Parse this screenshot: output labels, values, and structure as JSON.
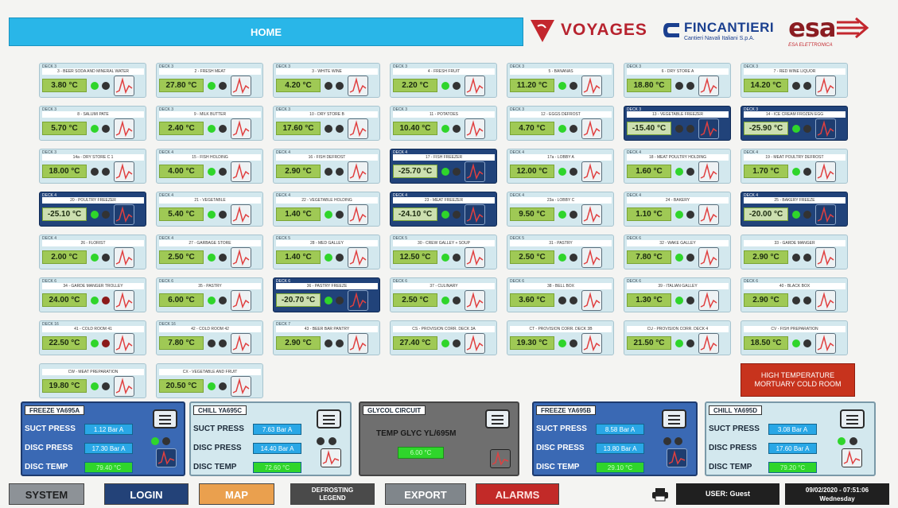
{
  "header": {
    "home_label": "HOME",
    "brands": {
      "voyages": "VOYAGES",
      "fincantieri": "FINCANTIERI",
      "fincantieri_sub": "Cantieri Navali Italiani S.p.A.",
      "esa": "esa",
      "esa_sub": "ESA ELETTRONICA"
    }
  },
  "tiles": [
    {
      "deck": "DECK 3",
      "name": "3 - BEER SODA AND MINERAL WATER",
      "temp": "3.80 °C",
      "d1": "#2fd52b",
      "d2": "#333",
      "frz": false
    },
    {
      "deck": "DECK 3",
      "name": "2 - FRESH MEAT",
      "temp": "27.80 °C",
      "d1": "#2fd52b",
      "d2": "#333",
      "frz": false
    },
    {
      "deck": "DECK 3",
      "name": "3 - WHITE WINE",
      "temp": "4.20 °C",
      "d1": "#333",
      "d2": "#333",
      "frz": false
    },
    {
      "deck": "DECK 3",
      "name": "4 - FRESH FRUIT",
      "temp": "2.20 °C",
      "d1": "#2fd52b",
      "d2": "#333",
      "frz": false
    },
    {
      "deck": "DECK 3",
      "name": "5 - BANANAS",
      "temp": "11.20 °C",
      "d1": "#2fd52b",
      "d2": "#333",
      "frz": false
    },
    {
      "deck": "DECK 3",
      "name": "6 - DRY STORE A",
      "temp": "18.80 °C",
      "d1": "#333",
      "d2": "#333",
      "frz": false
    },
    {
      "deck": "DECK 3",
      "name": "7 - RED WINE LIQUOR",
      "temp": "14.20 °C",
      "d1": "#333",
      "d2": "#333",
      "frz": false
    },
    {
      "deck": "DECK 3",
      "name": "8 - SALUMI PATE",
      "temp": "5.70 °C",
      "d1": "#2fd52b",
      "d2": "#333",
      "frz": false
    },
    {
      "deck": "DECK 3",
      "name": "9 - MILK BUTTER",
      "temp": "2.40 °C",
      "d1": "#2fd52b",
      "d2": "#333",
      "frz": false
    },
    {
      "deck": "DECK 3",
      "name": "10 - DRY STORE B",
      "temp": "17.60 °C",
      "d1": "#333",
      "d2": "#333",
      "frz": false
    },
    {
      "deck": "DECK 3",
      "name": "11 - POTATOES",
      "temp": "10.40 °C",
      "d1": "#2fd52b",
      "d2": "#333",
      "frz": false
    },
    {
      "deck": "DECK 3",
      "name": "12 - EGGS DEFROST",
      "temp": "4.70 °C",
      "d1": "#2fd52b",
      "d2": "#333",
      "frz": false
    },
    {
      "deck": "DECK 3",
      "name": "13 - VEGETABLE FREEZER",
      "temp": "-15.40 °C",
      "d1": "#333",
      "d2": "#333",
      "frz": true
    },
    {
      "deck": "DECK 3",
      "name": "14 - ICE CREAM FROZEN EGG",
      "temp": "-25.90 °C",
      "d1": "#2fd52b",
      "d2": "#333",
      "frz": true
    },
    {
      "deck": "DECK 3",
      "name": "14a - DRY STORE C 1",
      "temp": "18.00 °C",
      "d1": "#333",
      "d2": "#333",
      "frz": false
    },
    {
      "deck": "DECK 4",
      "name": "15 - FISH HOLDING",
      "temp": "4.00 °C",
      "d1": "#2fd52b",
      "d2": "#333",
      "frz": false
    },
    {
      "deck": "DECK 4",
      "name": "16 - FISH DEFROST",
      "temp": "2.90 °C",
      "d1": "#333",
      "d2": "#333",
      "frz": false
    },
    {
      "deck": "DECK 4",
      "name": "17 - FISH FREEZER",
      "temp": "-25.70 °C",
      "d1": "#2fd52b",
      "d2": "#333",
      "frz": true
    },
    {
      "deck": "DECK 4",
      "name": "17a - LOBBY A",
      "temp": "12.00 °C",
      "d1": "#2fd52b",
      "d2": "#333",
      "frz": false
    },
    {
      "deck": "DECK 4",
      "name": "18 - MEAT POULTRY HOLDING",
      "temp": "1.60 °C",
      "d1": "#2fd52b",
      "d2": "#333",
      "frz": false
    },
    {
      "deck": "DECK 4",
      "name": "19 - MEAT POULTRY DEFROST",
      "temp": "1.70 °C",
      "d1": "#2fd52b",
      "d2": "#333",
      "frz": false
    },
    {
      "deck": "DECK 4",
      "name": "20 - POULTRY FREEZER",
      "temp": "-25.10 °C",
      "d1": "#2fd52b",
      "d2": "#333",
      "frz": true
    },
    {
      "deck": "DECK 4",
      "name": "21 - VEGETABLE",
      "temp": "5.40 °C",
      "d1": "#2fd52b",
      "d2": "#333",
      "frz": false
    },
    {
      "deck": "DECK 4",
      "name": "22 - VEGETABLE HOLDING",
      "temp": "1.40 °C",
      "d1": "#2fd52b",
      "d2": "#333",
      "frz": false
    },
    {
      "deck": "DECK 4",
      "name": "23 - MEAT FREEZER",
      "temp": "-24.10 °C",
      "d1": "#2fd52b",
      "d2": "#333",
      "frz": true
    },
    {
      "deck": "DECK 4",
      "name": "23a - LOBBY C",
      "temp": "9.50 °C",
      "d1": "#2fd52b",
      "d2": "#333",
      "frz": false
    },
    {
      "deck": "DECK 4",
      "name": "24 - BAKERY",
      "temp": "1.10 °C",
      "d1": "#2fd52b",
      "d2": "#333",
      "frz": false
    },
    {
      "deck": "DECK 4",
      "name": "25 - BAKERY FREEZE",
      "temp": "-20.00 °C",
      "d1": "#2fd52b",
      "d2": "#333",
      "frz": true
    },
    {
      "deck": "DECK 4",
      "name": "26 - FLORIST",
      "temp": "2.00 °C",
      "d1": "#2fd52b",
      "d2": "#333",
      "frz": false
    },
    {
      "deck": "DECK 4",
      "name": "27 - GARBAGE STORE",
      "temp": "2.50 °C",
      "d1": "#2fd52b",
      "d2": "#333",
      "frz": false
    },
    {
      "deck": "DECK 5",
      "name": "28 - MED GALLEY",
      "temp": "1.40 °C",
      "d1": "#2fd52b",
      "d2": "#333",
      "frz": false
    },
    {
      "deck": "DECK 5",
      "name": "30 - CREW GALLEY + SOUP",
      "temp": "12.50 °C",
      "d1": "#2fd52b",
      "d2": "#333",
      "frz": false
    },
    {
      "deck": "DECK 5",
      "name": "31 - PASTRY",
      "temp": "2.50 °C",
      "d1": "#2fd52b",
      "d2": "#333",
      "frz": false
    },
    {
      "deck": "DECK 6",
      "name": "32 - WAKE GALLEY",
      "temp": "7.80 °C",
      "d1": "#2fd52b",
      "d2": "#333",
      "frz": false
    },
    {
      "deck": "",
      "name": "33 - GARDE MANGER",
      "temp": "2.90 °C",
      "d1": "#333",
      "d2": "#333",
      "frz": false
    },
    {
      "deck": "DECK 6",
      "name": "34 - GARDE MANGER TROLLEY",
      "temp": "24.00 °C",
      "d1": "#2fd52b",
      "d2": "#8b1a1a",
      "frz": false
    },
    {
      "deck": "DECK 6",
      "name": "35 - PASTRY",
      "temp": "6.00 °C",
      "d1": "#2fd52b",
      "d2": "#333",
      "frz": false
    },
    {
      "deck": "DECK 6",
      "name": "36 - PASTRY FREEZE",
      "temp": "-20.70 °C",
      "d1": "#2fd52b",
      "d2": "#333",
      "frz": true
    },
    {
      "deck": "DECK 6",
      "name": "37 - CULINARY",
      "temp": "2.50 °C",
      "d1": "#2fd52b",
      "d2": "#333",
      "frz": false
    },
    {
      "deck": "DECK 6",
      "name": "38 - BELL BOX",
      "temp": "3.60 °C",
      "d1": "#333",
      "d2": "#333",
      "frz": false
    },
    {
      "deck": "DECK 6",
      "name": "39 - ITALIAN GALLEY",
      "temp": "1.30 °C",
      "d1": "#2fd52b",
      "d2": "#333",
      "frz": false
    },
    {
      "deck": "DECK 6",
      "name": "40 - BLACK BOX",
      "temp": "2.90 °C",
      "d1": "#333",
      "d2": "#333",
      "frz": false
    },
    {
      "deck": "DECK 16",
      "name": "41 - COLD ROOM 41",
      "temp": "22.50 °C",
      "d1": "#2fd52b",
      "d2": "#8b1a1a",
      "frz": false
    },
    {
      "deck": "DECK 16",
      "name": "42 - COLD ROOM 42",
      "temp": "7.80 °C",
      "d1": "#333",
      "d2": "#333",
      "frz": false
    },
    {
      "deck": "DECK 7",
      "name": "43 - BEER BAR PANTRY",
      "temp": "2.90 °C",
      "d1": "#333",
      "d2": "#333",
      "frz": false
    },
    {
      "deck": "",
      "name": "CS - PROVISION CORR. DECK 3A",
      "temp": "27.40 °C",
      "d1": "#2fd52b",
      "d2": "#333",
      "frz": false
    },
    {
      "deck": "",
      "name": "CT - PROVISION CORR. DECK 3B",
      "temp": "19.30 °C",
      "d1": "#2fd52b",
      "d2": "#333",
      "frz": false
    },
    {
      "deck": "",
      "name": "CU - PROVISION CORR. DECK 4",
      "temp": "21.50 °C",
      "d1": "#2fd52b",
      "d2": "#333",
      "frz": false
    },
    {
      "deck": "",
      "name": "CV - FISH PREPARATION",
      "temp": "18.50 °C",
      "d1": "#2fd52b",
      "d2": "#333",
      "frz": false
    },
    {
      "deck": "",
      "name": "CW - MEAT PREPARATION",
      "temp": "19.80 °C",
      "d1": "#2fd52b",
      "d2": "#333",
      "frz": false
    },
    {
      "deck": "",
      "name": "CX - VEGETABLE AND FRUIT",
      "temp": "20.50 °C",
      "d1": "#2fd52b",
      "d2": "#333",
      "frz": false
    }
  ],
  "mortuary_alarm": "HIGH TEMPERATURE\nMORTUARY COLD ROOM",
  "panels": [
    {
      "title": "FREEZE YA695A",
      "suct_label": "SUCT PRESS",
      "suct": "1.12 Bar A",
      "disc_label": "DISC PRESS",
      "disc": "17.30 Bar A",
      "temp_label": "DISC TEMP",
      "temp": "79.40 °C"
    },
    {
      "title": "CHILL YA695C",
      "suct_label": "SUCT PRESS",
      "suct": "7.63 Bar A",
      "disc_label": "DISC PRESS",
      "disc": "14.40 Bar A",
      "temp_label": "DISC TEMP",
      "temp": "72.60 °C"
    },
    {
      "title": "GLYCOL CIRCUIT",
      "label": "TEMP GLYC YL/695M",
      "value": "6.00 °C"
    },
    {
      "title": "FREEZE YA695B",
      "suct_label": "SUCT PRESS",
      "suct": "8.58 Bar A",
      "disc_label": "DISC PRESS",
      "disc": "13.80 Bar A",
      "temp_label": "DISC TEMP",
      "temp": "29.10 °C"
    },
    {
      "title": "CHILL YA695D",
      "suct_label": "SUCT PRESS",
      "suct": "3.08 Bar A",
      "disc_label": "DISC PRESS",
      "disc": "17.60 Bar A",
      "temp_label": "DISC TEMP",
      "temp": "79.20 °C"
    }
  ],
  "footer": {
    "system": "SYSTEM",
    "login": "LOGIN",
    "map": "MAP",
    "defrosting_1": "DEFROSTING",
    "defrosting_2": "LEGEND",
    "export": "EXPORT",
    "alarms": "ALARMS",
    "user": "USER: Guest",
    "datetime": "09/02/2020 - 07:51:06",
    "weekday": "Wednesday"
  }
}
